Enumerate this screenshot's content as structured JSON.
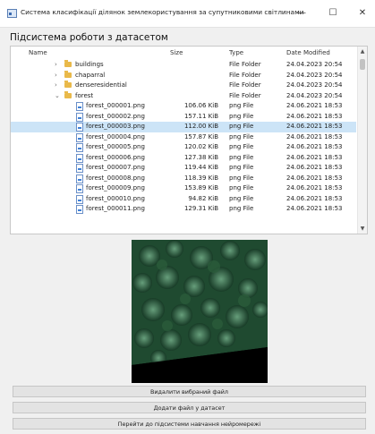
{
  "window": {
    "title": "Система класифікації ділянок землекористування за супутниковими світлинами",
    "minimize_glyph": "—",
    "maximize_glyph": "☐",
    "close_glyph": "✕"
  },
  "subtitle": "Підсистема роботи з датасетом",
  "tree": {
    "columns": {
      "name": "Name",
      "size": "Size",
      "type": "Type",
      "date": "Date Modified"
    },
    "rows": [
      {
        "kind": "folder",
        "expanded": false,
        "name": "buildings",
        "size": "",
        "type": "File Folder",
        "date": "24.04.2023 20:54"
      },
      {
        "kind": "folder",
        "expanded": false,
        "name": "chaparral",
        "size": "",
        "type": "File Folder",
        "date": "24.04.2023 20:54"
      },
      {
        "kind": "folder",
        "expanded": false,
        "name": "denseresidential",
        "size": "",
        "type": "File Folder",
        "date": "24.04.2023 20:54"
      },
      {
        "kind": "folder",
        "expanded": true,
        "name": "forest",
        "size": "",
        "type": "File Folder",
        "date": "24.04.2023 20:54"
      },
      {
        "kind": "file",
        "name": "forest_000001.png",
        "size": "106.06 KiB",
        "type": "png File",
        "date": "24.06.2021 18:53"
      },
      {
        "kind": "file",
        "name": "forest_000002.png",
        "size": "157.11 KiB",
        "type": "png File",
        "date": "24.06.2021 18:53"
      },
      {
        "kind": "file",
        "name": "forest_000003.png",
        "size": "112.00 KiB",
        "type": "png File",
        "date": "24.06.2021 18:53",
        "selected": true
      },
      {
        "kind": "file",
        "name": "forest_000004.png",
        "size": "157.87 KiB",
        "type": "png File",
        "date": "24.06.2021 18:53"
      },
      {
        "kind": "file",
        "name": "forest_000005.png",
        "size": "120.02 KiB",
        "type": "png File",
        "date": "24.06.2021 18:53"
      },
      {
        "kind": "file",
        "name": "forest_000006.png",
        "size": "127.38 KiB",
        "type": "png File",
        "date": "24.06.2021 18:53"
      },
      {
        "kind": "file",
        "name": "forest_000007.png",
        "size": "119.44 KiB",
        "type": "png File",
        "date": "24.06.2021 18:53"
      },
      {
        "kind": "file",
        "name": "forest_000008.png",
        "size": "118.39 KiB",
        "type": "png File",
        "date": "24.06.2021 18:53"
      },
      {
        "kind": "file",
        "name": "forest_000009.png",
        "size": "153.89 KiB",
        "type": "png File",
        "date": "24.06.2021 18:53"
      },
      {
        "kind": "file",
        "name": "forest_000010.png",
        "size": "94.82 KiB",
        "type": "png File",
        "date": "24.06.2021 18:53"
      },
      {
        "kind": "file",
        "name": "forest_000011.png",
        "size": "129.31 KiB",
        "type": "png File",
        "date": "24.06.2021 18:53"
      }
    ]
  },
  "buttons": {
    "delete": "Видалити вибраний файл",
    "add": "Додати файл у датасет",
    "goto_training": "Перейти до підсистеми навчання нейромережі"
  }
}
